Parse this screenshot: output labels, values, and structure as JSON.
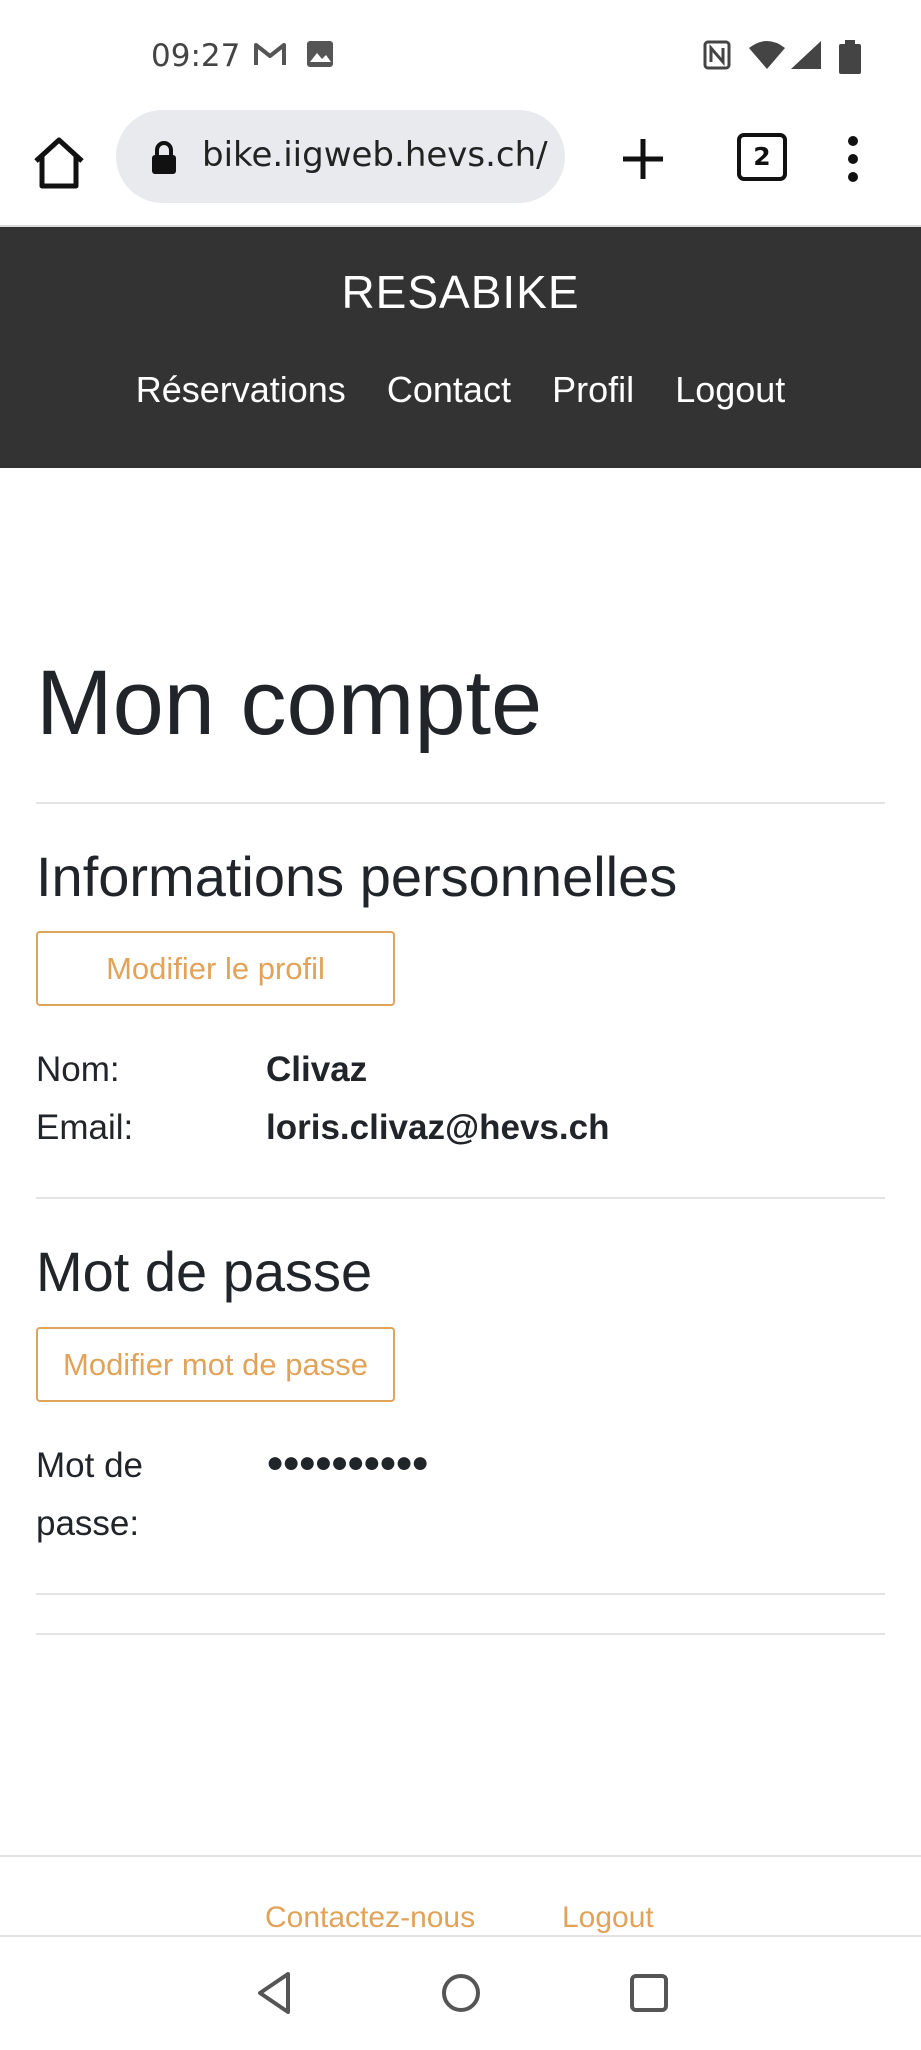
{
  "status_bar": {
    "time": "09:27"
  },
  "browser": {
    "url": "bike.iigweb.hevs.ch/",
    "tab_count": "2"
  },
  "site": {
    "brand": "RESABIKE",
    "nav": [
      "Réservations",
      "Contact",
      "Profil",
      "Logout"
    ]
  },
  "page": {
    "title": "Mon compte",
    "personal": {
      "heading": "Informations personnelles",
      "edit_button": "Modifier le profil",
      "name_label": "Nom:",
      "name_value": "Clivaz",
      "email_label": "Email:",
      "email_value": "loris.clivaz@hevs.ch"
    },
    "password": {
      "heading": "Mot de passe",
      "edit_button": "Modifier mot de passe",
      "label_line1": "Mot de",
      "label_line2": "passe:",
      "value": "●●●●●●●●●●"
    }
  },
  "footer": {
    "contact": "Contactez-nous",
    "logout": "Logout"
  },
  "colors": {
    "header_bg": "#333333",
    "accent": "#e0a35a",
    "url_bg": "#e9eaee"
  },
  "icons": [
    "gmail-icon",
    "image-icon",
    "nfc-icon",
    "wifi-icon",
    "signal-icon",
    "battery-icon",
    "home-icon",
    "lock-icon",
    "plus-icon",
    "tabs-icon",
    "more-icon",
    "back-icon",
    "home-circle-icon",
    "recents-icon"
  ]
}
